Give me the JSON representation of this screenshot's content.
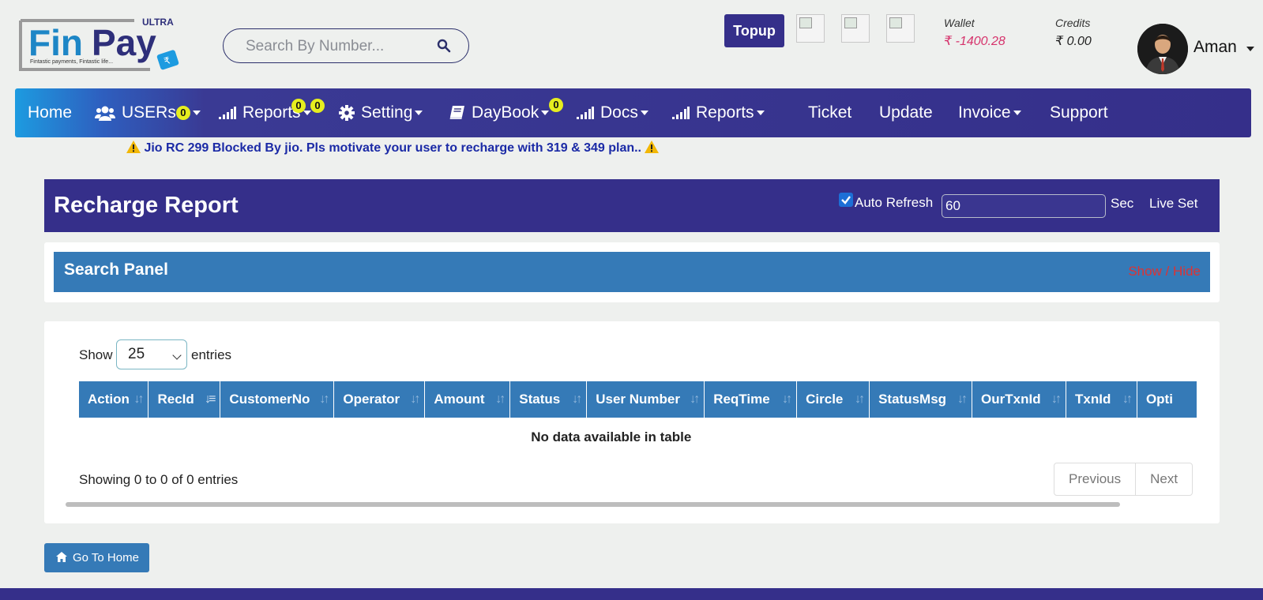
{
  "brand": {
    "name_part1": "Fin",
    "name_part2": "Pay",
    "tag": "ULTRA",
    "tagline": "Fintastic payments, Fintastic life..."
  },
  "search": {
    "placeholder": "Search By Number..."
  },
  "header": {
    "topup_label": "Topup",
    "wallet": {
      "label": "Wallet",
      "value": "₹ -1400.28"
    },
    "credits": {
      "label": "Credits",
      "value": "₹ 0.00"
    },
    "user": {
      "name": "Aman"
    }
  },
  "nav": {
    "items": [
      {
        "label": "Home"
      },
      {
        "label": "USERs",
        "badge": "0"
      },
      {
        "label": "Reports",
        "badges": [
          "0",
          "0"
        ]
      },
      {
        "label": "Setting"
      },
      {
        "label": "DayBook",
        "badge": "0"
      },
      {
        "label": "Docs"
      },
      {
        "label": "Reports"
      },
      {
        "label": "Ticket"
      },
      {
        "label": "Update"
      },
      {
        "label": "Invoice"
      },
      {
        "label": "Support"
      }
    ]
  },
  "notice": "Jio RC 299 Blocked By jio. Pls motivate your user to recharge with 319 & 349 plan..",
  "report": {
    "title": "Recharge Report",
    "auto_refresh_label": "Auto Refresh",
    "auto_refresh_checked": true,
    "refresh_value": "60",
    "sec_label": "Sec",
    "live_set_label": "Live Set"
  },
  "search_panel": {
    "title": "Search Panel",
    "toggle_label": "Show / Hide"
  },
  "table": {
    "show_label": "Show",
    "entries_value": "25",
    "entries_label": "entries",
    "columns": [
      "Action",
      "RecId",
      "CustomerNo",
      "Operator",
      "Amount",
      "Status",
      "User Number",
      "ReqTime",
      "Circle",
      "StatusMsg",
      "OurTxnId",
      "TxnId",
      "Opti"
    ],
    "empty_message": "No data available in table",
    "info": "Showing 0 to 0 of 0 entries",
    "prev_label": "Previous",
    "next_label": "Next"
  },
  "go_home_label": "Go To Home",
  "colors": {
    "primary_dark": "#352f8a",
    "panel_blue": "#357ab7",
    "badge_yellow": "#e6ee1f",
    "wallet_pink": "#d6336c",
    "toggle_red": "#dd3333"
  }
}
